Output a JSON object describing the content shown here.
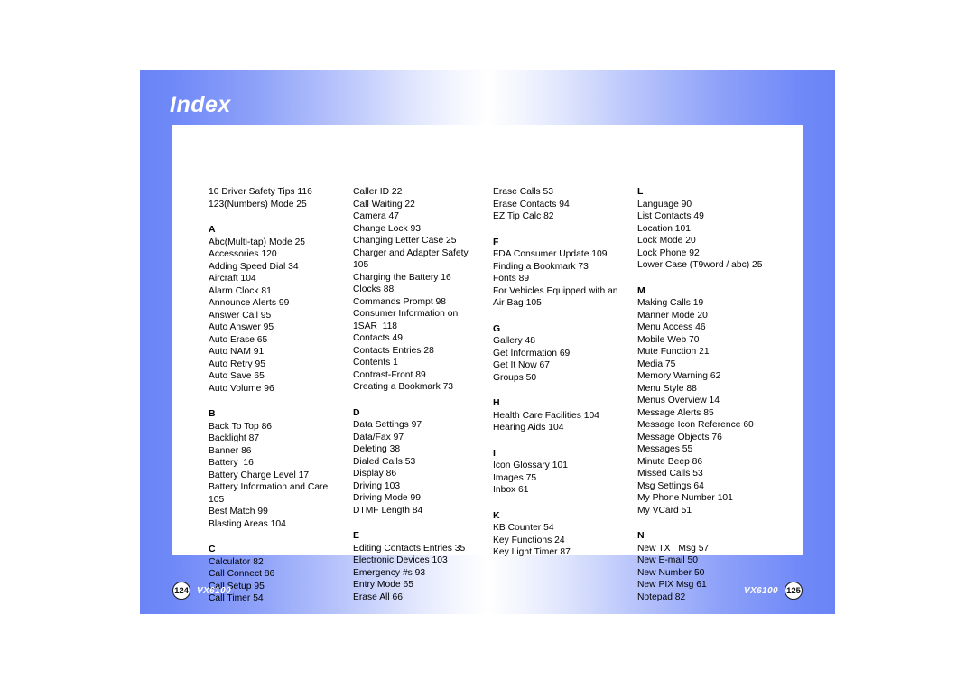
{
  "document": {
    "title": "Index",
    "model": "VX6100"
  },
  "pages": [
    {
      "side": "left",
      "page_number": "124",
      "model_label": "VX6100",
      "columns": [
        {
          "blocks": [
            {
              "letter": "",
              "entries": [
                "10 Driver Safety Tips 116",
                "123(Numbers) Mode 25"
              ]
            },
            {
              "letter": "A",
              "entries": [
                "Abc(Multi-tap) Mode 25",
                "Accessories 120",
                "Adding Speed Dial 34",
                "Aircraft 104",
                "Alarm Clock 81",
                "Announce Alerts 99",
                "Answer Call 95",
                "Auto Answer 95",
                "Auto Erase 65",
                "Auto NAM 91",
                "Auto Retry 95",
                "Auto Save 65",
                "Auto Volume 96"
              ]
            },
            {
              "letter": "B",
              "entries": [
                "Back To Top 86",
                "Backlight 87",
                "Banner 86",
                "Battery  16",
                "Battery Charge Level 17",
                "Battery Information and Care",
                "105",
                "Best Match 99",
                "Blasting Areas 104"
              ]
            },
            {
              "letter": "C",
              "entries": [
                "Calculator 82",
                "Call Connect 86",
                "Call Setup 95",
                "Call Timer 54"
              ]
            }
          ]
        },
        {
          "blocks": [
            {
              "letter": "",
              "entries": [
                "Caller ID 22",
                "Call Waiting 22",
                "Camera 47",
                "Change Lock 93",
                "Changing Letter Case 25",
                "Charger and Adapter Safety",
                "105",
                "Charging the Battery 16",
                "Clocks 88",
                "Commands Prompt 98",
                "Consumer Information on",
                "1SAR  118",
                "Contacts 49",
                "Contacts Entries 28",
                "Contents 1",
                "Contrast-Front 89",
                "Creating a Bookmark 73"
              ]
            },
            {
              "letter": "D",
              "entries": [
                "Data Settings 97",
                "Data/Fax 97",
                "Deleting 38",
                "Dialed Calls 53",
                "Display 86",
                "Driving 103",
                "Driving Mode 99",
                "DTMF Length 84"
              ]
            },
            {
              "letter": "E",
              "entries": [
                "Editing Contacts Entries 35",
                "Electronic Devices 103",
                "Emergency #s 93",
                "Entry Mode 65",
                "Erase All 66"
              ]
            }
          ]
        }
      ]
    },
    {
      "side": "right",
      "page_number": "125",
      "model_label": "VX6100",
      "columns": [
        {
          "blocks": [
            {
              "letter": "",
              "entries": [
                "Erase Calls 53",
                "Erase Contacts 94",
                "EZ Tip Calc 82"
              ]
            },
            {
              "letter": "F",
              "entries": [
                "FDA Consumer Update 109",
                "Finding a Bookmark 73",
                "Fonts 89",
                "For Vehicles Equipped with an",
                "Air Bag 105"
              ]
            },
            {
              "letter": "G",
              "entries": [
                "Gallery 48",
                "Get Information 69",
                "Get It Now 67",
                "Groups 50"
              ]
            },
            {
              "letter": "H",
              "entries": [
                "Health Care Facilities 104",
                "Hearing Aids 104"
              ]
            },
            {
              "letter": "I",
              "entries": [
                "Icon Glossary 101",
                "Images 75",
                "Inbox 61"
              ]
            },
            {
              "letter": "K",
              "entries": [
                "KB Counter 54",
                "Key Functions 24",
                "Key Light Timer 87"
              ]
            }
          ]
        },
        {
          "blocks": [
            {
              "letter": "L",
              "entries": [
                "Language 90",
                "List Contacts 49",
                "Location 101",
                "Lock Mode 20",
                "Lock Phone 92",
                "Lower Case (T9word / abc) 25"
              ]
            },
            {
              "letter": "M",
              "entries": [
                "Making Calls 19",
                "Manner Mode 20",
                "Menu Access 46",
                "Mobile Web 70",
                "Mute Function 21",
                "Media 75",
                "Memory Warning 62",
                "Menu Style 88",
                "Menus Overview 14",
                "Message Alerts 85",
                "Message Icon Reference 60",
                "Message Objects 76",
                "Messages 55",
                "Minute Beep 86",
                "Missed Calls 53",
                "Msg Settings 64",
                "My Phone Number 101",
                "My VCard 51"
              ]
            },
            {
              "letter": "N",
              "entries": [
                "New TXT Msg 57",
                "New E-mail 50",
                "New Number 50",
                "New PIX Msg 61",
                "Notepad 82"
              ]
            }
          ]
        }
      ]
    }
  ]
}
